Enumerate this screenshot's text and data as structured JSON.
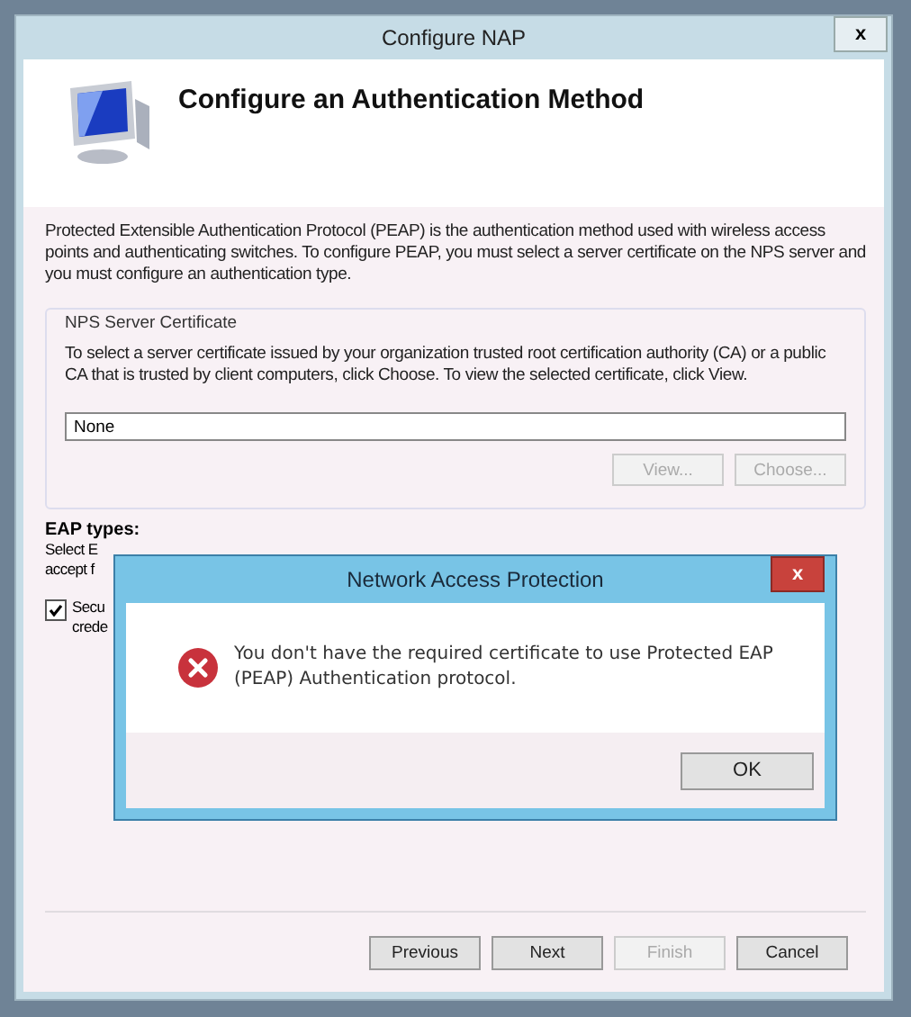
{
  "window": {
    "title": "Configure NAP",
    "close": "x"
  },
  "header": {
    "title": "Configure an Authentication Method"
  },
  "intro": "Protected Extensible Authentication Protocol (PEAP) is the authentication method used with wireless access points and authenticating switches. To configure PEAP, you must select a server certificate on the NPS server and you must configure an authentication type.",
  "certificate_group": {
    "title": "NPS Server Certificate",
    "description": "To select a server certificate issued by your organization trusted root certification authority (CA) or a public CA that is trusted by client computers, click Choose. To view the selected certificate, click View.",
    "value": "None",
    "buttons": [
      {
        "label": "View...",
        "disabled": true
      },
      {
        "label": "Choose...",
        "disabled": true
      }
    ]
  },
  "eap_types": {
    "title": "EAP types:",
    "description_lines": [
      "Select E",
      "accept f"
    ],
    "checkbox": {
      "label_lines": [
        "Secu",
        "crede"
      ],
      "checked": true
    }
  },
  "buttons": [
    {
      "label": "Previous",
      "disabled": false
    },
    {
      "label": "Next",
      "disabled": false
    },
    {
      "label": "Finish",
      "disabled": true
    },
    {
      "label": "Cancel",
      "disabled": false
    }
  ],
  "dialog": {
    "title": "Network Access Protection",
    "close": "x",
    "message": "You don't have the required certificate to use Protected EAP (PEAP) Authentication protocol.",
    "button": "OK"
  }
}
